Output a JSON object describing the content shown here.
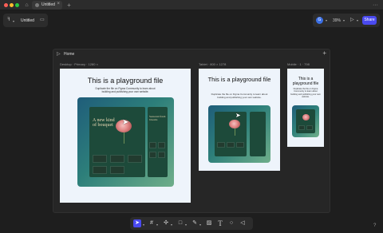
{
  "window": {
    "tab_title": "Untitled"
  },
  "file": {
    "name": "Untitled"
  },
  "header": {
    "avatar_initial": "G",
    "zoom": "39%",
    "share_label": "Share"
  },
  "section": {
    "title": "Home"
  },
  "frames": {
    "desktop": {
      "label": "Desktop · Primary · 1280 ×",
      "title": "This is a playground file",
      "desc": "Duplicate the file on Figma Community to learn about building and publishing your own website.",
      "card_headline": "A new kind of bouquet",
      "card_side_headline": "Seasonal fresh blooms"
    },
    "tablet": {
      "label": "Tablet · 800 × 1278",
      "title": "This is a playground file",
      "desc": "Duplicate the file on Figma Community to learn about building and publishing your own website."
    },
    "mobile": {
      "label": "Mobile · 1 · 798",
      "title": "This is a playground file",
      "desc": "Duplicate the file on Figma Community to learn about building and publishing your own website."
    }
  },
  "toolbar": {
    "tools": [
      "move-tool",
      "frame-tool",
      "component-tool",
      "shape-tool",
      "pen-tool",
      "image-tool",
      "text-tool",
      "comment-tool",
      "action-tool"
    ]
  },
  "help": {
    "label": "?"
  },
  "colors": {
    "accent": "#4a4af0",
    "canvas": "#1e1e1e",
    "panel": "#2c2c2c"
  }
}
